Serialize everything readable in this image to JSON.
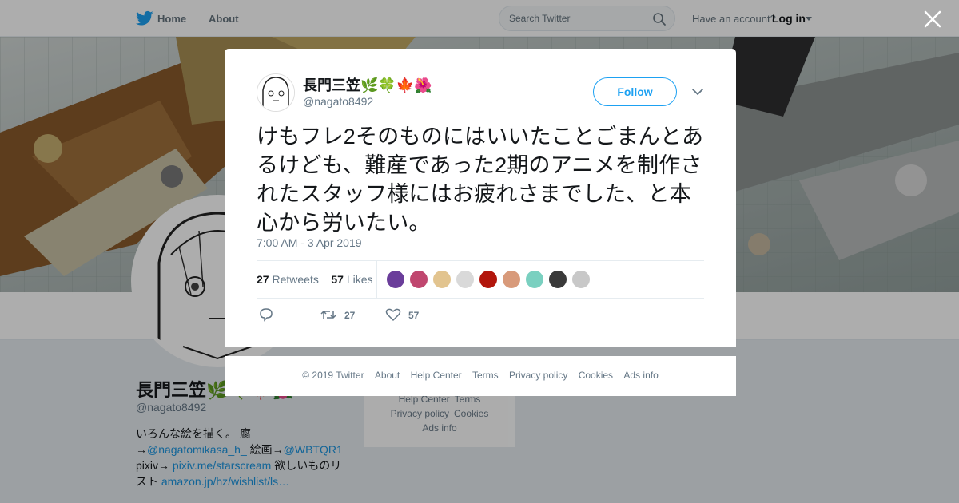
{
  "topnav": {
    "home_label": "Home",
    "about_label": "About",
    "search_placeholder": "Search Twitter",
    "have_account": "Have an account?",
    "login_label": "Log in"
  },
  "profile": {
    "name": "長門三笠🌿🍀🍁🌺",
    "handle": "@nagato8492",
    "bio_line1": "いろんな絵を描く。 腐",
    "bio_arrow1": "→",
    "bio_link1": "@nagatomikasa_h_",
    "bio_mid1": " 絵画→",
    "bio_link2": "@WBTQR1",
    "bio_pixiv": "pixiv→ ",
    "bio_link3": "pixiv.me/starscream",
    "bio_wish": " 欲しいものリスト ",
    "bio_link4": "amazon.jp/hz/wishlist/ls…"
  },
  "side_footer": {
    "help_center": "Help Center",
    "terms": "Terms",
    "privacy": "Privacy policy",
    "cookies": "Cookies",
    "ads_info": "Ads info"
  },
  "tweet": {
    "author_name": "長門三笠🌿🍀🍁🌺",
    "author_handle": "@nagato8492",
    "follow_label": "Follow",
    "text": "けもフレ2そのものにはいいたことごまんとあるけども、難産であった2期のアニメを制作されたスタッフ様にはお疲れさまでした、と本心から労いたい。",
    "timestamp": "7:00 AM - 3 Apr 2019",
    "retweets_count": "27",
    "retweets_label": "Retweets",
    "likes_count": "57",
    "likes_label": "Likes",
    "action_retweet_count": "27",
    "action_like_count": "57",
    "liker_colors": [
      "#6a3d9a",
      "#c0476f",
      "#e2c48f",
      "#d9d9d9",
      "#b2160c",
      "#d89a7a",
      "#7ad0c0",
      "#3a3a3a",
      "#c8c8c8"
    ]
  },
  "footer": {
    "copyright": "© 2019 Twitter",
    "about": "About",
    "help_center": "Help Center",
    "terms": "Terms",
    "privacy": "Privacy policy",
    "cookies": "Cookies",
    "ads_info": "Ads info"
  },
  "colors": {
    "accent": "#1da1f2",
    "link": "#1b95e0",
    "muted": "#657786"
  },
  "icons": {
    "bird": "twitter-bird-icon",
    "search": "search-icon",
    "close": "close-icon",
    "reply": "reply-icon",
    "retweet": "retweet-icon",
    "like": "heart-icon"
  }
}
